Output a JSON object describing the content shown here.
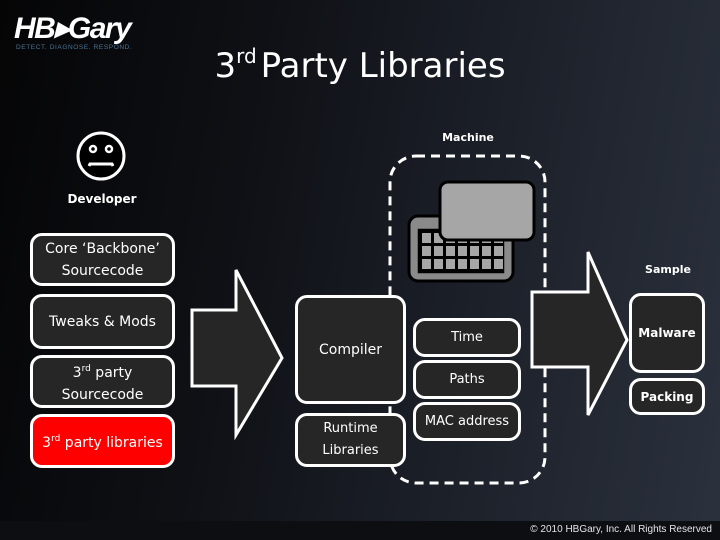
{
  "logo": {
    "name": "HB▸Gary",
    "tagline": "DETECT.  DIAGNOSE.  RESPOND."
  },
  "title": {
    "prefix": "3",
    "superscript": "rd",
    "rest": "Party Libraries"
  },
  "developer": {
    "icon": "sad-face-icon",
    "label": "Developer"
  },
  "source_stack": [
    {
      "line1": "Core ‘Backbone’",
      "line2": "Sourcecode",
      "highlight": false
    },
    {
      "line1": "Tweaks & Mods",
      "line2": "",
      "highlight": false
    },
    {
      "line1_prefix": "3",
      "line1_sup": "rd",
      "line1_rest": " party",
      "line2": "Sourcecode",
      "highlight": false
    },
    {
      "prefix": "3",
      "sup": "rd",
      "rest": " party libraries",
      "highlight": true,
      "color": "#ff0000"
    }
  ],
  "build": {
    "compiler": "Compiler",
    "runtime_line1": "Runtime",
    "runtime_line2": "Libraries"
  },
  "machine": {
    "label": "Machine",
    "icon": "computer-icon",
    "items": [
      "Time",
      "Paths",
      "MAC address"
    ]
  },
  "sample": {
    "label": "Sample",
    "malware": "Malware",
    "packing": "Packing"
  },
  "footer": {
    "copyright": "© 2010 HBGary, Inc. All Rights Reserved"
  },
  "colors": {
    "highlight": "#ff0000",
    "box_fill": "#262626",
    "stroke": "#ffffff"
  }
}
